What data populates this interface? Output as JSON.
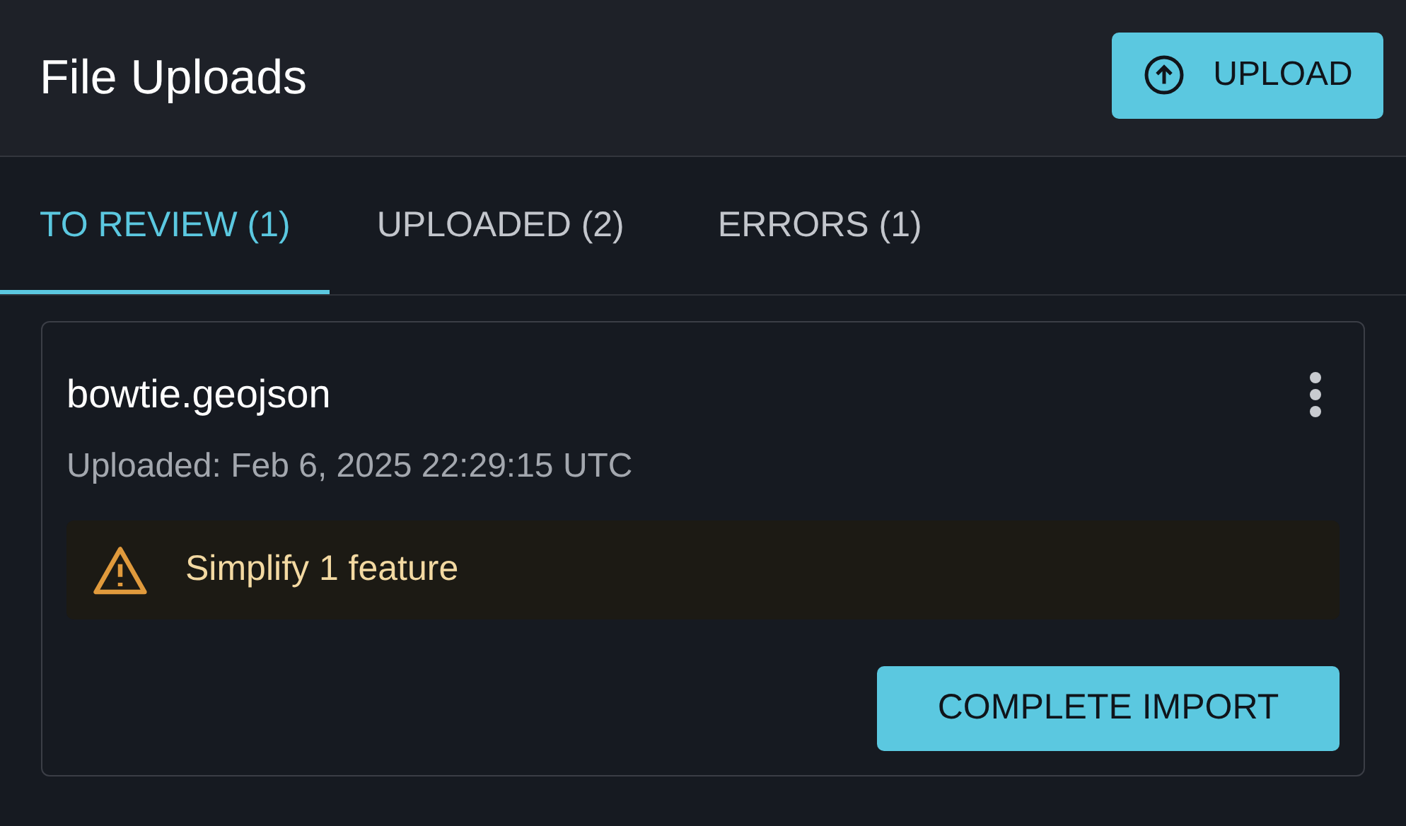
{
  "header": {
    "title": "File Uploads",
    "upload_button": "UPLOAD"
  },
  "tabs": [
    {
      "label": "TO REVIEW (1)",
      "selected": true
    },
    {
      "label": "UPLOADED (2)",
      "selected": false
    },
    {
      "label": "ERRORS (1)",
      "selected": false
    }
  ],
  "files": [
    {
      "name": "bowtie.geojson",
      "uploaded": "Uploaded: Feb 6, 2025 22:29:15 UTC",
      "warning": "Simplify 1 feature",
      "action": "COMPLETE IMPORT"
    }
  ]
}
